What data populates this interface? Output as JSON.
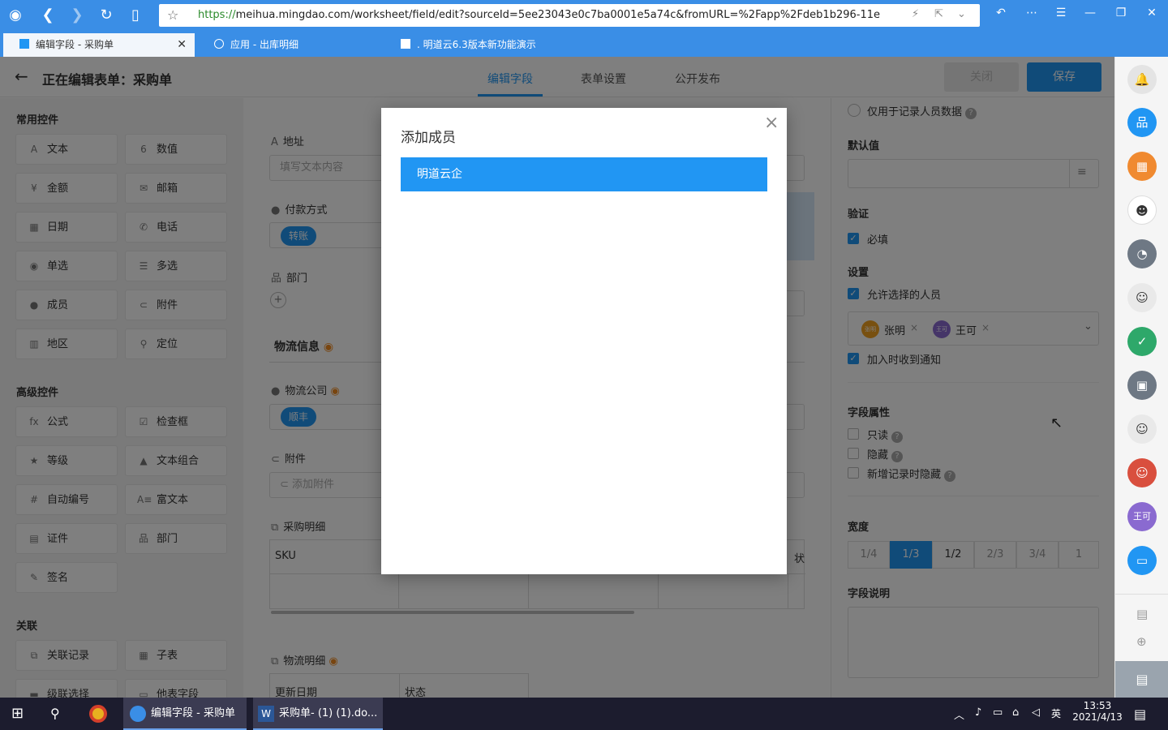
{
  "browser": {
    "url": "https://meihua.mingdao.com/worksheet/field/edit?sourceId=5ee23043e0c7ba0001e5a74c&fromURL=%2Fapp%2Fdeb1b296-11e",
    "url_protocol": "https://",
    "url_rest": "meihua.mingdao.com/worksheet/field/edit?sourceId=5ee23043e0c7ba0001e5a74c&fromURL=%2Fapp%2Fdeb1b296-11e",
    "tabs": [
      {
        "label": "编辑字段 - 采购单",
        "active": true
      },
      {
        "label": "应用 - 出库明细",
        "active": false
      },
      {
        "label": ". 明道云6.3版本新功能演示",
        "active": false
      }
    ]
  },
  "header": {
    "title": "正在编辑表单：采购单",
    "tabs": [
      "编辑字段",
      "表单设置",
      "公开发布"
    ],
    "close_label": "关闭",
    "save_label": "保存"
  },
  "left": {
    "common_title": "常用控件",
    "common": [
      {
        "label": "文本",
        "icon": "A"
      },
      {
        "label": "数值",
        "icon": "6"
      },
      {
        "label": "金额",
        "icon": "¥"
      },
      {
        "label": "邮箱",
        "icon": "✉"
      },
      {
        "label": "日期",
        "icon": "▦"
      },
      {
        "label": "电话",
        "icon": "✆"
      },
      {
        "label": "单选",
        "icon": "◉"
      },
      {
        "label": "多选",
        "icon": "☰"
      },
      {
        "label": "成员",
        "icon": "●"
      },
      {
        "label": "附件",
        "icon": "⊂"
      },
      {
        "label": "地区",
        "icon": "▥"
      },
      {
        "label": "定位",
        "icon": "⚲"
      }
    ],
    "advanced_title": "高级控件",
    "advanced": [
      {
        "label": "公式",
        "icon": "fx"
      },
      {
        "label": "检查框",
        "icon": "☑"
      },
      {
        "label": "等级",
        "icon": "★"
      },
      {
        "label": "文本组合",
        "icon": "▲"
      },
      {
        "label": "自动编号",
        "icon": "#"
      },
      {
        "label": "富文本",
        "icon": "A≡"
      },
      {
        "label": "证件",
        "icon": "▤"
      },
      {
        "label": "部门",
        "icon": "品"
      },
      {
        "label": "签名",
        "icon": "✎"
      }
    ],
    "relation_title": "关联",
    "relation": [
      {
        "label": "关联记录",
        "icon": "⧉"
      },
      {
        "label": "子表",
        "icon": "▦"
      },
      {
        "label": "级联选择",
        "icon": "▬"
      },
      {
        "label": "他表字段",
        "icon": "▭"
      }
    ]
  },
  "center": {
    "address_label": "地址",
    "address_placeholder": "填写文本内容",
    "payment_label": "付款方式",
    "payment_chip": "转账",
    "dept_label": "部门",
    "logistics_section": "物流信息",
    "logistics_company_label": "物流公司",
    "logistics_chip": "顺丰",
    "attachment_label": "附件",
    "attachment_btn": "添加附件",
    "purchase_detail_label": "采购明细",
    "sku_col": "SKU",
    "status_col_partial": "状",
    "logistics_detail_label": "物流明细",
    "update_date_col": "更新日期",
    "status_col": "状态"
  },
  "right": {
    "record_only": "仅用于记录人员数据",
    "default_label": "默认值",
    "validation_label": "验证",
    "required": "必填",
    "settings_label": "设置",
    "allow_select": "允许选择的人员",
    "members": [
      {
        "name": "张明",
        "color": "#f0a020",
        "avatar_text": "张明"
      },
      {
        "name": "王可",
        "color": "#8a6ad0",
        "avatar_text": "王可"
      }
    ],
    "notify_on_join": "加入时收到通知",
    "field_props_label": "字段属性",
    "readonly": "只读",
    "hidden": "隐藏",
    "hidden_on_new": "新增记录时隐藏",
    "width_label": "宽度",
    "widths": [
      "1/4",
      "1/3",
      "1/2",
      "2/3",
      "3/4",
      "1"
    ],
    "width_selected": "1/3",
    "desc_label": "字段说明"
  },
  "sidebar": {
    "wangke_avatar": "王可"
  },
  "modal": {
    "title": "添加成员",
    "org_item": "明道云企"
  },
  "taskbar": {
    "app1": "编辑字段 - 采购单",
    "app2": "采购单- (1) (1).do...",
    "time": "13:53",
    "date": "2021/4/13",
    "ime": "英"
  },
  "colors": {
    "accent": "#2196f3",
    "browser_bar": "#3a8ee6"
  }
}
